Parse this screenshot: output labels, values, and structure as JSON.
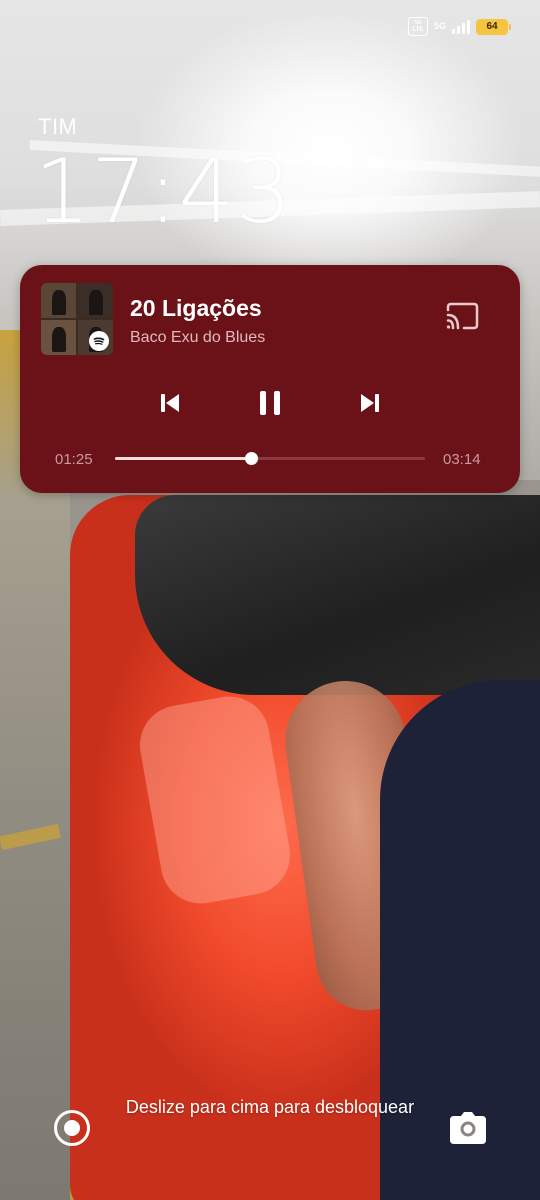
{
  "status_bar": {
    "volte_top": "Vo",
    "volte_bottom": "LTE",
    "network": "5G",
    "battery": "64"
  },
  "lockscreen": {
    "carrier": "TIM",
    "time": "17:43",
    "unlock_hint": "Deslize para cima para desbloquear"
  },
  "media": {
    "title": "20 Ligações",
    "artist": "Baco Exu do Blues",
    "elapsed": "01:25",
    "total": "03:14",
    "progress_fraction": 0.438,
    "card_color": "#6b1219",
    "app_icon": "spotify-icon"
  },
  "icons": {
    "cast": "cast-icon",
    "prev": "skip-previous-icon",
    "pause": "pause-icon",
    "next": "skip-next-icon",
    "home": "circle-home-icon",
    "camera": "camera-icon"
  }
}
